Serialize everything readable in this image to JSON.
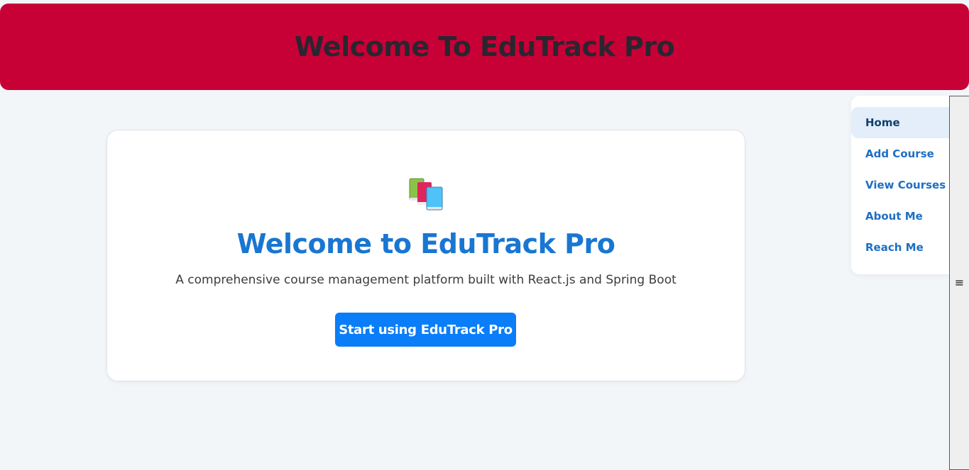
{
  "header": {
    "title": "Welcome To EduTrack Pro"
  },
  "hero": {
    "icon": "books-icon",
    "title": "Welcome to EduTrack Pro",
    "subtitle": "A comprehensive course management platform built with React.js and Spring Boot",
    "cta_label": "Start using EduTrack Pro"
  },
  "sidebar": {
    "items": [
      {
        "label": "Home",
        "active": true
      },
      {
        "label": "Add Course",
        "active": false
      },
      {
        "label": "View Courses",
        "active": false
      },
      {
        "label": "About Me",
        "active": false
      },
      {
        "label": "Reach Me",
        "active": false
      }
    ],
    "toggle_icon": "≡"
  },
  "colors": {
    "banner": "#c70036",
    "accent": "#1976d2",
    "button": "#0a7df8",
    "background": "#f3f6f9"
  }
}
